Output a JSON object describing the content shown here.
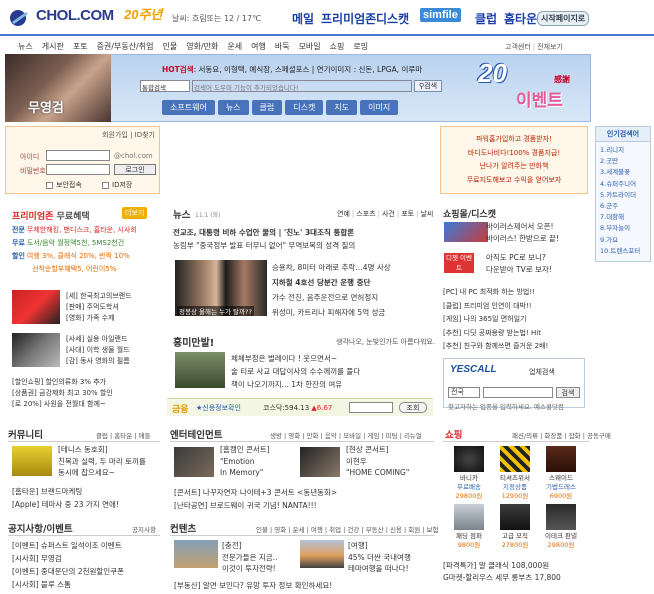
{
  "header": {
    "logo_text": "CHOL.COM",
    "badge": "20주년",
    "weather": "날씨: 흐림또는 12 / 17℃",
    "nav": {
      "mail": "메일",
      "premium": "프리미엄존",
      "discat": "디스캣",
      "simfile": "simfile",
      "club": "클럽",
      "home": "홈타운",
      "startpage": "시작페이지로"
    }
  },
  "menu": {
    "items": [
      "뉴스",
      "게시판",
      "포토",
      "증권/부동산/취업",
      "인물",
      "영화/만화",
      "운세",
      "여행",
      "바둑",
      "모바일",
      "쇼핑",
      "로밍"
    ],
    "right": [
      "고객센터",
      "전체보기"
    ]
  },
  "banner": {
    "title": "무영검",
    "hot_label": "HOT검색",
    "hot_text": ": 서동요, 이형택, 예식장, 스페셜포스 | 연기이미지 : 신돈, LPGA, 이루마",
    "select": "통합검색",
    "placeholder": "검색어 도우미 기능이 추가되었습니다!",
    "search_btn": "검색",
    "nav": [
      "소프트웨어",
      "뉴스",
      "클럽",
      "디스캣",
      "지도",
      "이미지"
    ],
    "event_num": "20",
    "event_text": "이벤트",
    "event_tag": "感謝"
  },
  "login": {
    "header": "회원가입 | ID찾기",
    "id_label": "아이디",
    "pw_label": "비밀번호",
    "domain": "@chol.com",
    "button": "로그인",
    "secure": "보안접속",
    "save_id": "ID저장"
  },
  "premium": {
    "title": "프리미엄존",
    "subtitle": "무료혜택",
    "more": "더보기",
    "rows": [
      {
        "tag": "전문",
        "text": "무제한해킹, 팬디스크, 홈타운, 시사회"
      },
      {
        "tag": "무료",
        "text": "도서/음악 월정액5천, 5MS2천건"
      },
      {
        "tag": "할인",
        "text": "여행 3%, 클래식 20%, 반짝 10%"
      },
      {
        "tag": "",
        "text": "선착순할부혜택5, 어린이5%"
      }
    ],
    "img1_items": [
      "[세] 한국최고의브랜드",
      "[판매] 주먹도학셔",
      "[영화] 가족 수제"
    ],
    "img2_items": [
      "[사세] 실용 아일랜드",
      "[사대] 이학 생물 월드",
      "[감] 동사 영화의 필름"
    ],
    "bank": [
      "[할인쇼핑] 할인의류화 3% 추가",
      "[상품권] 금강제화 최고 30% 할인",
      "[로 20%] 사원을 전월대 함께~"
    ]
  },
  "news": {
    "title": "뉴스",
    "date": "11.1 (화)",
    "tabs": [
      "연예",
      "스포츠",
      "사건",
      "포토",
      "날씨"
    ],
    "headlines": [
      "전교조, 대통령 비하 수업안 물의 | '친노' 3대조직 통합론",
      "농림부 \"중국정부 발표 터무니 없어\" 무역보복의 성격 질의"
    ],
    "photo_caption": "정봉상 올해는 누가 탈까??",
    "side": [
      "승용차, 8미터 아래로 추락…4명 사상",
      "지하철 4호선 당분간 운행 중단",
      "가수 전진, 음주운전으로 면허정지",
      "위성미, 카트리나 피해자에 5억 성금"
    ]
  },
  "humor": {
    "title": "흥미만발!",
    "right": "생각나오, 눈빛인가도 아름다워요.",
    "items": [
      "체체부정은 벌레이다 ! 웃으면서~",
      "술 티로 사교 대답이사의 수수께끼를 풀다",
      "책이 나오기까지... 1차 한잔의 여유"
    ]
  },
  "stock": {
    "label": "금융",
    "link": "★신용정보확인",
    "index": "코스닥:594.13",
    "change": "▲6.67",
    "button": "조회"
  },
  "shopping_top": {
    "title": "쇼핑몰/",
    "title2": "디스캣",
    "item1": [
      "바이러스제어서 오픈!",
      "바이러스! 한방으로 끝!"
    ],
    "item2_tag": "디젯 이벤트",
    "item2": [
      "아직도 PC로 보니?",
      "다운받아 TV로 보자!"
    ],
    "pc_list": [
      "[PC] 내 PC 최적화 하는 방법!!",
      "[클럽] 프리미엄 인연이 대박!!",
      "[게임] 나의 365일 면허일기",
      "[추천] 디딧 공짜용량 받는법! Hit",
      "[추천] 친구와 함께쓰면 즐거운 2배!"
    ]
  },
  "yescall": {
    "logo": "YESCALL",
    "sub": "업체검색",
    "select": "전국",
    "button": "검색",
    "hint": "찾고자하는 업종을 입력하세요. 예스콜닷컴"
  },
  "ad1": [
    "파워홈가입하고 경품받자!",
    "바디도나비다!100% 경품지급!",
    "난나가 알려주는 만화책",
    "무료지도해보고 수익을 얻어보자"
  ],
  "rank": {
    "title": "인기검색어",
    "items": [
      "1.리니지",
      "2.굿딴",
      "3.세계불꽃",
      "4.슈퍼주니어",
      "5.카트라이더",
      "6.군주",
      "7.대항해",
      "8.부자놀이",
      "9.가요",
      "10.트렌스포터"
    ]
  },
  "community": {
    "title": "커뮤니티",
    "links": "클럽 | 홈타운 | 애들",
    "img_items": [
      "[테니스 동호회]",
      "친목과 실력, 두 마리 토끼를",
      "동시에 잡으세요~"
    ],
    "items": [
      "[홈타운] 브랜드마케팅",
      "[Apple] 테마사 중 23 가지 연애!"
    ]
  },
  "notice": {
    "title": "공지사항/이벤트",
    "links": "공지사항",
    "items": [
      "[이벤트] 슈퍼스트 일석이조 이벤트",
      "[시사회] 무영검",
      "[이벤트] 중대문단의 2천원할인쿠폰",
      "[시사회] 블루 스톰"
    ]
  },
  "entertainment": {
    "title": "엔터테인먼트",
    "links": "생방 | 영화 | 만화 | 음악 | 모바일 | 게임 | 미팅 | 리뉴얼",
    "e1": [
      "[홈캠인 콘서트]",
      "\"Emotion",
      "In Memory\""
    ],
    "e2": [
      "[현상 콘서트]",
      "이현우",
      "\"HOME COMING\""
    ],
    "items": [
      "[콘서트] 나꾸자연자 나이테+3 콘서트 <동년동화>",
      "[난타공연] 브로드웨이 귀국 기념! NANTA!!!"
    ]
  },
  "contents": {
    "title": "컨텐츠",
    "links": "인물 | 영화 | 운세 | 여행 | 취업 | 건강 | 부동산 | 신용 | 회원 | 보험",
    "c1": [
      "[충전]",
      "전문가들은 지금..",
      "이것이 투자전략!"
    ],
    "c2": [
      "[여행]",
      "45% 더싼 국내여행",
      "테마여행을 떠나다!"
    ],
    "foot": "[부동산] 알면 보인다? 유망 투자 정보 확인하세요!"
  },
  "shopping": {
    "title": "쇼핑",
    "links": "패션/의류 | 화장품 | 잡화 | 공동구매",
    "products": [
      {
        "name": "바니카",
        "desc": "무료배송",
        "price": "29800원"
      },
      {
        "name": "티셔츠위서",
        "desc": "지정상품",
        "price": "12900원"
      },
      {
        "name": "스웨이드",
        "desc": "기법드레스",
        "price": "6900원"
      },
      {
        "name": "패딩 점퍼",
        "desc": "특가",
        "price": "9800원"
      },
      {
        "name": "고급 모직",
        "desc": "코트",
        "price": "27800원"
      },
      {
        "name": "이테크 판넬",
        "desc": "특가",
        "price": "29800원"
      }
    ],
    "list": [
      "[파격특가] 말 클래식 108,000원",
      "G마켓-할리우스 세무 롱부츠 17,800"
    ]
  },
  "colors": {
    "accent": "#2a5db0",
    "header_line": "#4a77c9",
    "premium": "#d22"
  }
}
